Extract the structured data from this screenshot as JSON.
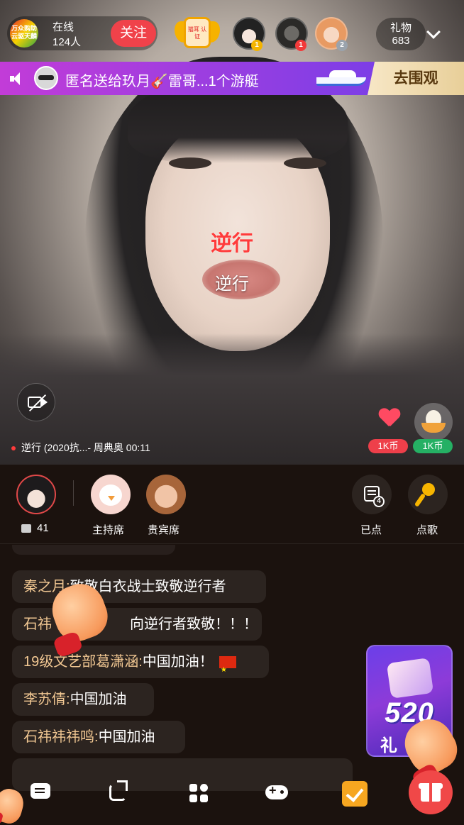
{
  "top_bar": {
    "host_logo_text": "万众购助 云驱天麟",
    "online_label": "在线",
    "online_count": "124人",
    "follow_label": "关注",
    "badge_text": "猫耳 认证",
    "viewer_ranks": [
      "1",
      "1",
      "2"
    ],
    "gift_label": "礼物",
    "gift_count": "683"
  },
  "banner": {
    "message": "匿名送给玖月🎸雷哥...1个游艇",
    "action_label": "去围观",
    "gradient_start": "#c23cd8",
    "gradient_end": "#6a40e4"
  },
  "video": {
    "lyric_main": "逆行",
    "lyric_sub": "逆行",
    "song_info": "逆行 (2020抗...- 周典奥 00:11",
    "heart_coin": "1K币",
    "egg_coin": "1K币"
  },
  "seats": {
    "gift_count": "41",
    "host_seat_label": "主持席",
    "guest_seat_label": "贵宾席",
    "picked_label": "已点",
    "picked_badge": "4",
    "request_label": "点歌"
  },
  "chat": {
    "messages": [
      {
        "user": "秦之月:",
        "text": "致敬白衣战士致敬逆行者"
      },
      {
        "user": "石祎",
        "text": "向逆行者致敬！！！"
      },
      {
        "user": "19级文艺部葛潇涵:",
        "text": "中国加油！"
      },
      {
        "user": "李苏倩:",
        "text": "中国加油"
      },
      {
        "user": "石祎祎祎鸣:",
        "text": "中国加油"
      }
    ]
  },
  "promo": {
    "big_text": "520",
    "sub_text": "礼"
  },
  "bottom_bar": {
    "icons": [
      "chat-bubble-icon",
      "share-icon",
      "apps-grid-icon",
      "gamepad-icon",
      "task-check-icon",
      "gift-box-icon"
    ]
  },
  "colors": {
    "follow": "#f0424a",
    "username": "#f2c893",
    "coin_red": "#ee3f4a",
    "coin_green": "#25b064",
    "gift_fab": "#f04848"
  }
}
